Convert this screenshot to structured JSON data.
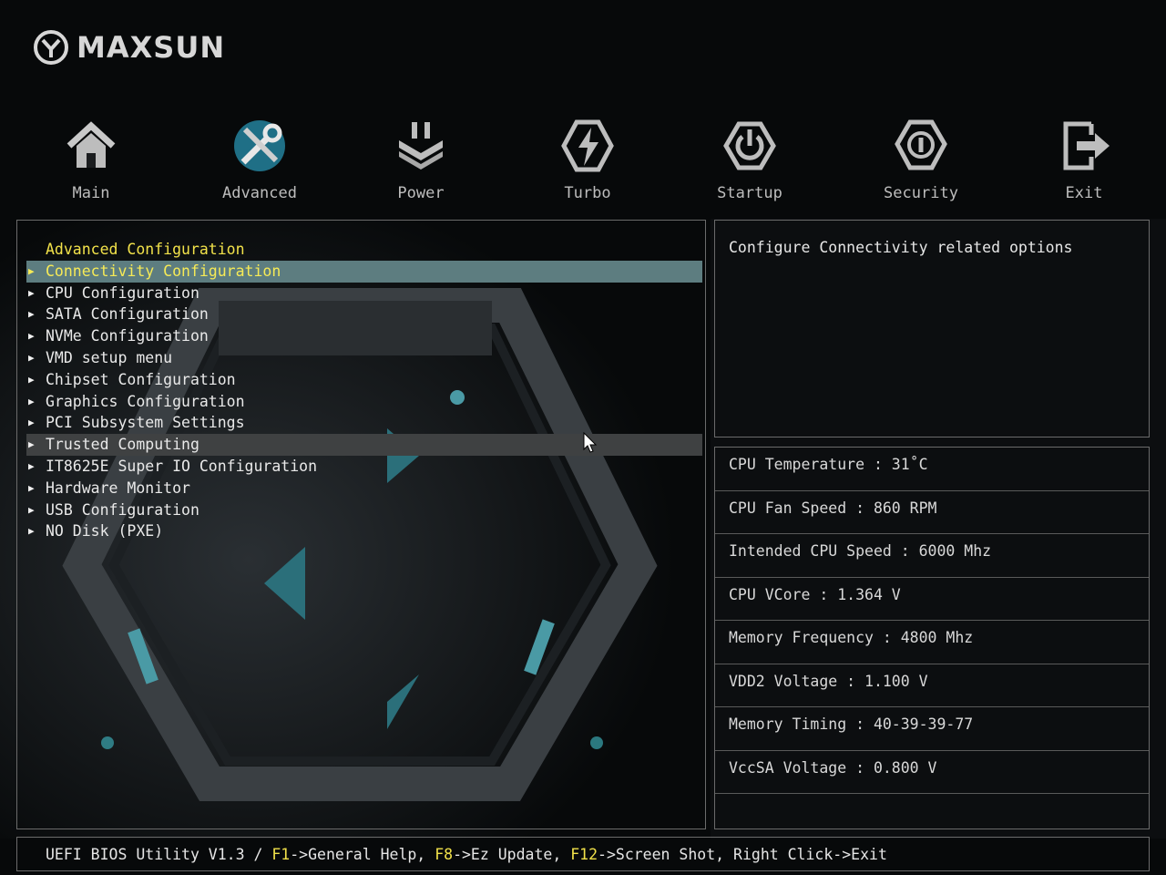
{
  "brand": {
    "name": "MAXSUN"
  },
  "tabs": [
    {
      "label": "Main",
      "icon": "home-icon"
    },
    {
      "label": "Advanced",
      "icon": "tools-icon",
      "active": true
    },
    {
      "label": "Power",
      "icon": "power-plug-icon"
    },
    {
      "label": "Turbo",
      "icon": "lightning-icon"
    },
    {
      "label": "Startup",
      "icon": "power-button-icon"
    },
    {
      "label": "Security",
      "icon": "shield-icon"
    },
    {
      "label": "Exit",
      "icon": "exit-icon"
    }
  ],
  "menu": {
    "heading": "Advanced Configuration",
    "items": [
      {
        "label": "Connectivity Configuration",
        "state": "selected"
      },
      {
        "label": "CPU Configuration"
      },
      {
        "label": "SATA Configuration"
      },
      {
        "label": "NVMe Configuration"
      },
      {
        "label": "VMD setup menu"
      },
      {
        "label": "Chipset Configuration"
      },
      {
        "label": "Graphics Configuration"
      },
      {
        "label": "PCI Subsystem Settings"
      },
      {
        "label": "Trusted Computing",
        "state": "hover"
      },
      {
        "label": "IT8625E Super IO Configuration"
      },
      {
        "label": "Hardware Monitor"
      },
      {
        "label": "USB Configuration"
      },
      {
        "label": "NO Disk (PXE)"
      }
    ]
  },
  "help": {
    "text": "Configure Connectivity related options"
  },
  "stats": [
    "CPU Temperature : 31˚C",
    "CPU Fan Speed : 860 RPM",
    "Intended CPU Speed : 6000 Mhz",
    "CPU VCore : 1.364 V",
    "Memory Frequency : 4800 Mhz",
    "VDD2 Voltage : 1.100 V",
    "Memory Timing : 40-39-39-77",
    "VccSA Voltage : 0.800 V"
  ],
  "footer": {
    "version": "UEFI BIOS Utility V1.3 / ",
    "f1_key": "F1",
    "f1_text": "->General Help, ",
    "f8_key": "F8",
    "f8_text": "->Ez Update, ",
    "f12_key": "F12",
    "f12_text": "->Screen Shot, Right Click->Exit"
  },
  "colors": {
    "accent_yellow": "#f2e24a",
    "selection_bg": "#5d7d80",
    "hover_bg": "#3f4142",
    "active_tab_icon": "#2a8fa8"
  }
}
